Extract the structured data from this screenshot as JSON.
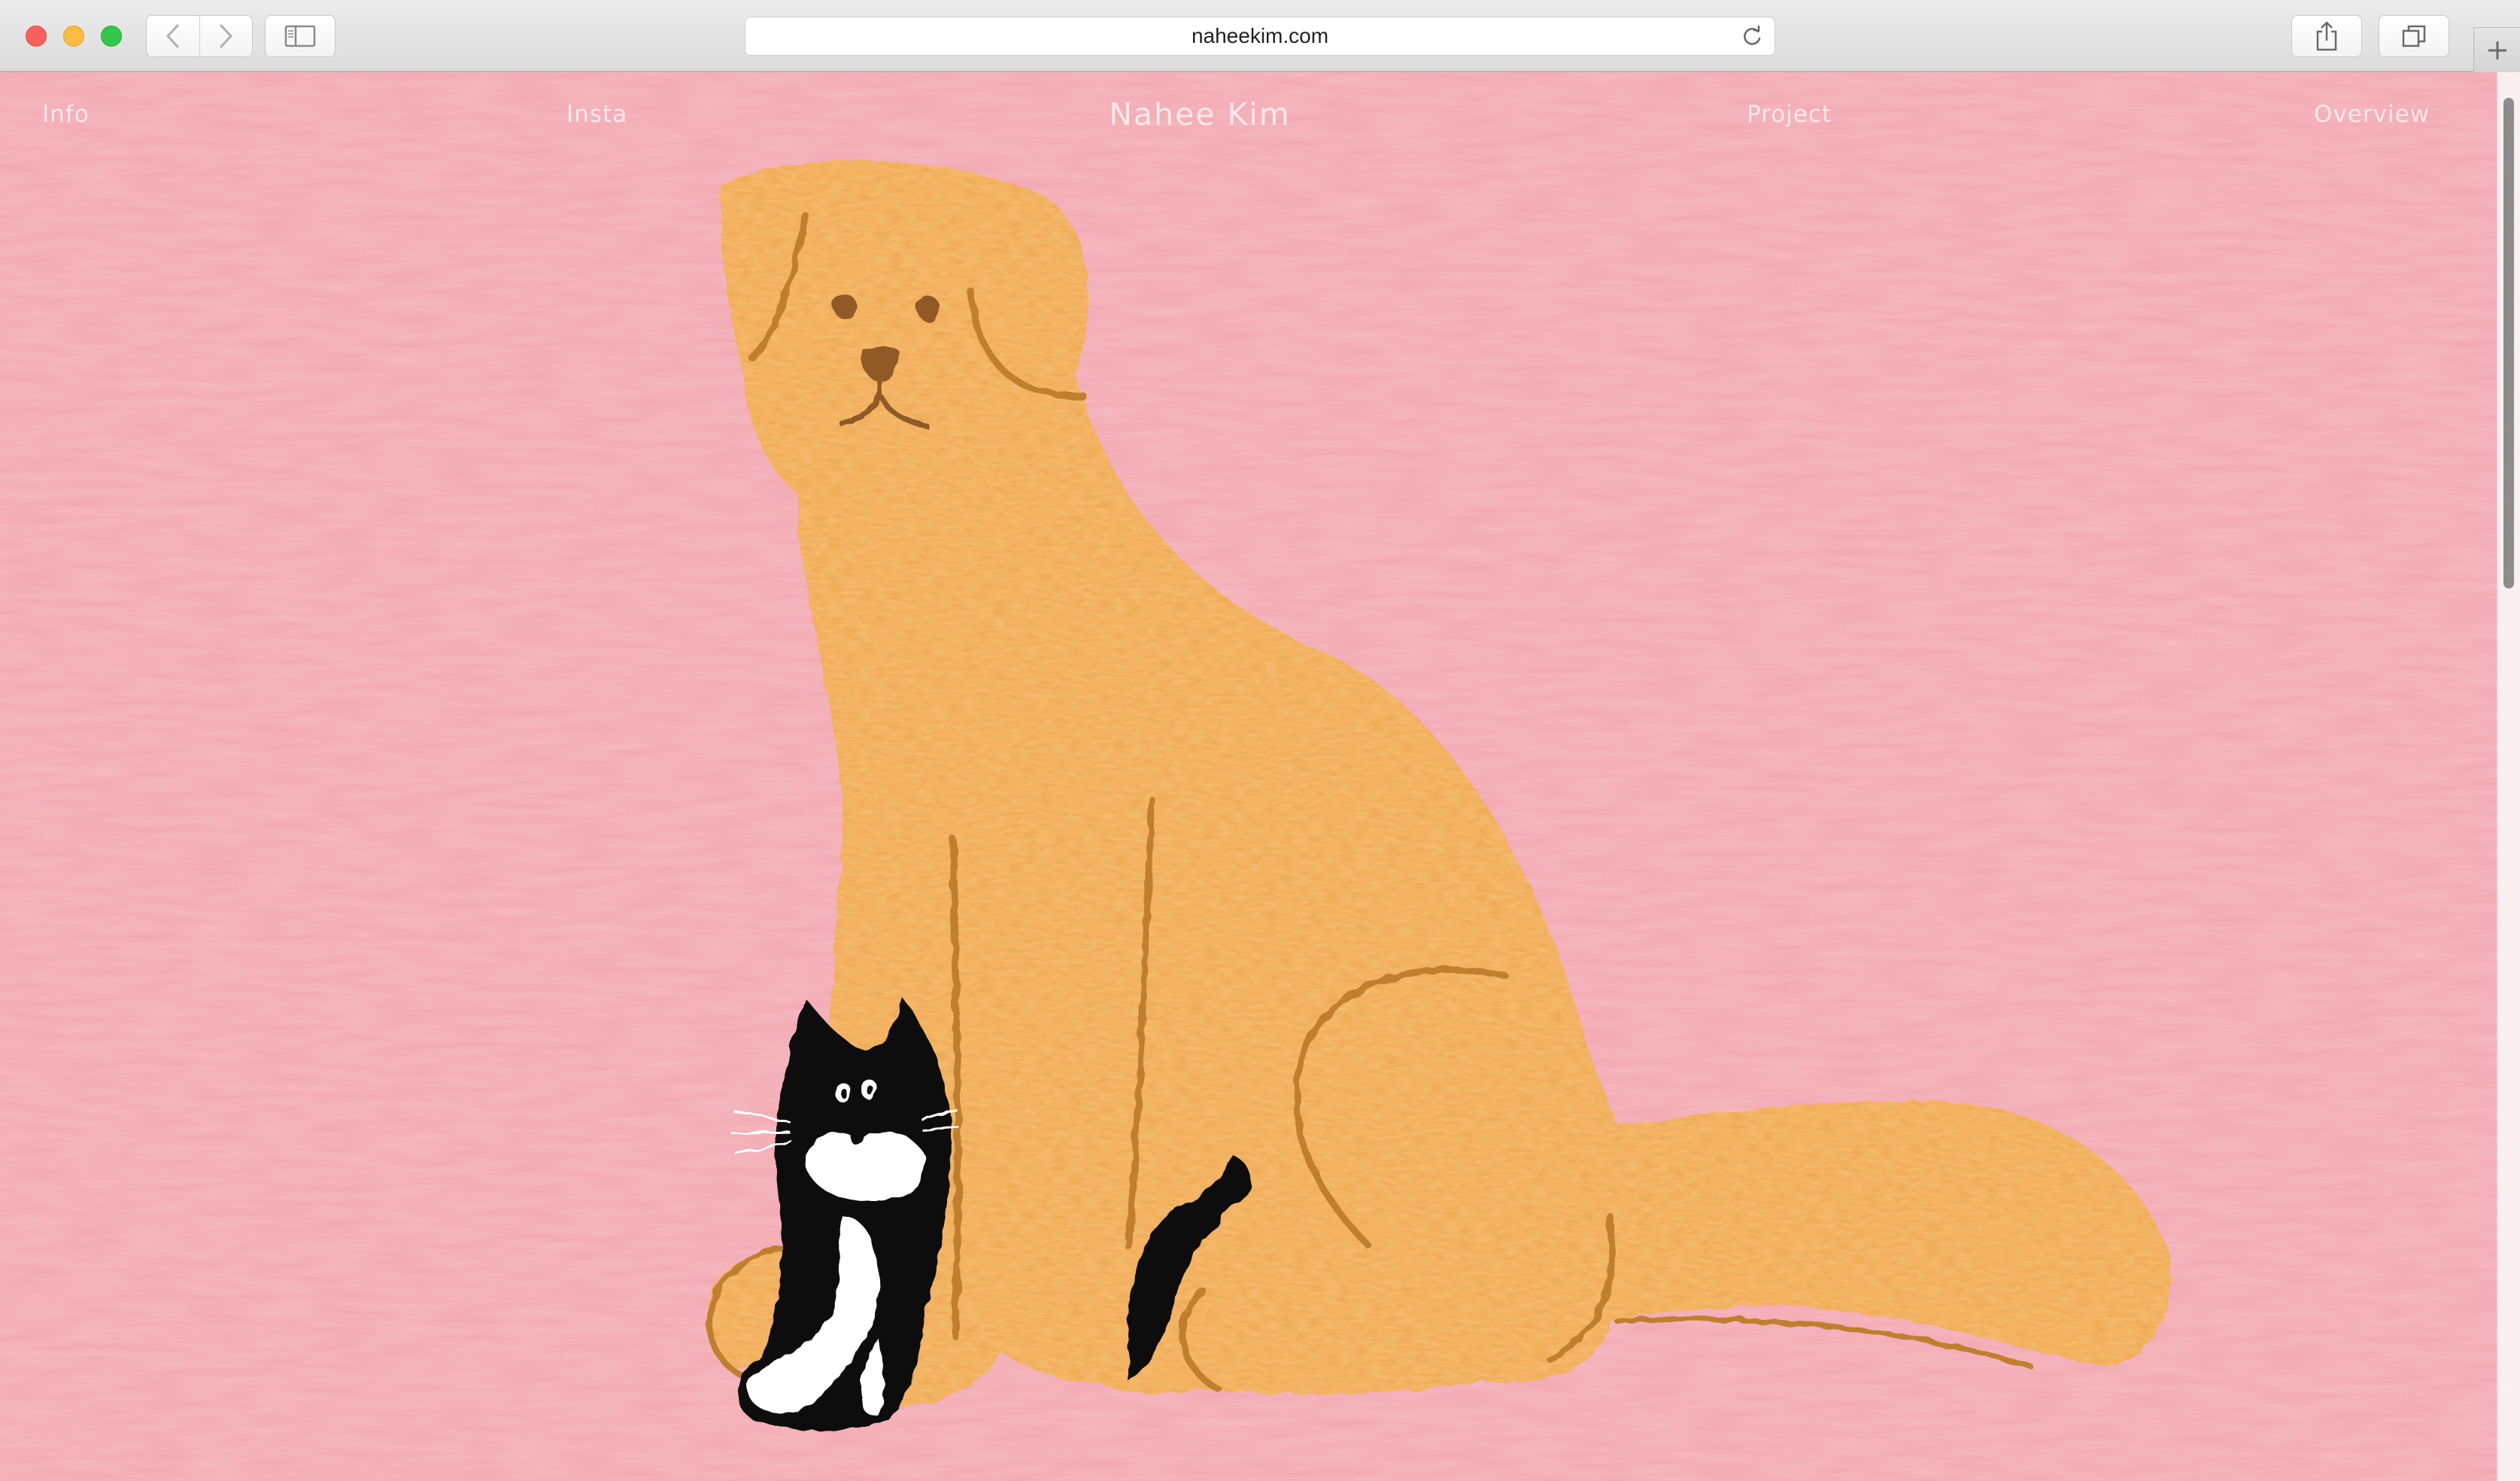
{
  "browser": {
    "url": "naheekim.com",
    "icons": {
      "back": "chevron-left-icon",
      "forward": "chevron-right-icon",
      "sidebar": "sidebar-icon",
      "reload": "reload-icon",
      "share": "share-icon",
      "tabs": "tabs-icon",
      "new_tab": "plus-icon"
    }
  },
  "site": {
    "title": "Nahee Kim",
    "nav": {
      "info": "Info",
      "insta": "Insta",
      "project": "Project",
      "overview": "Overview"
    }
  },
  "hero": {
    "illustration": "dog-and-cat-illustration",
    "colors": {
      "background": "#f2a7b0",
      "dog": "#f0aa55",
      "dog_outline": "#bf7f2f",
      "cat": "#111111",
      "cat_white": "#ffffff"
    }
  }
}
